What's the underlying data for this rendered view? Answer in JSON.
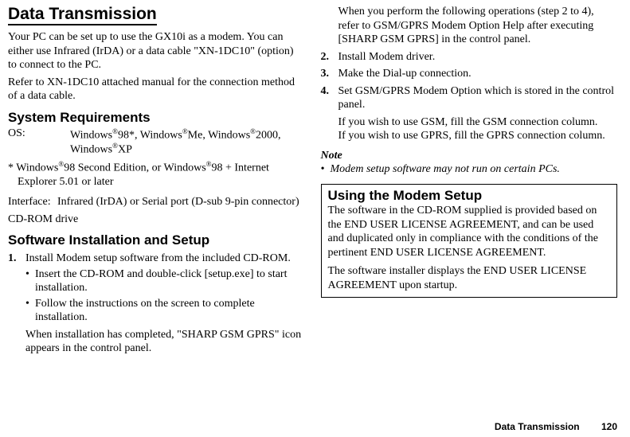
{
  "left": {
    "title": "Data Transmission",
    "p1": "Your PC can be set up to use the GX10i as a modem. You can either use Infrared (IrDA) or a data cable \"XN-1DC10\" (option) to connect to the PC.",
    "p2": "Refer to XN-1DC10 attached manual for the connection method of a data cable.",
    "sysreq_title": "System Requirements",
    "os_label": "OS:",
    "os_val_a": "Windows",
    "os_val_b": "98*, Windows",
    "os_val_c": "Me, Windows",
    "os_val_d": "2000, Windows",
    "os_val_e": "XP",
    "fn_a": "* Windows",
    "fn_b": "98 Second Edition, or Windows",
    "fn_c": "98 + Internet Explorer 5.01 or later",
    "iface_label": "Interface:",
    "iface_val": "Infrared (IrDA) or Serial port (D-sub 9-pin connector)",
    "cdrom": "CD-ROM drive",
    "sw_title": "Software Installation and Setup",
    "steps": [
      {
        "num": "1.",
        "text": "Install Modem setup software from the included CD-ROM.",
        "bullets": [
          "Insert the CD-ROM and double-click [setup.exe] to start installation.",
          "Follow the instructions on the screen to complete installation."
        ],
        "follow": "When installation has completed, \"SHARP GSM GPRS\" icon appears in the control panel."
      }
    ]
  },
  "right": {
    "cont": "When you perform the following operations (step 2 to 4), refer to GSM/GPRS Modem Option Help after executing [SHARP GSM GPRS] in the control panel.",
    "steps": [
      {
        "num": "2.",
        "text": "Install Modem driver."
      },
      {
        "num": "3.",
        "text": "Make the Dial-up connection."
      },
      {
        "num": "4.",
        "text": "Set GSM/GPRS Modem Option which is stored in the control panel.",
        "follow1": "If you wish to use GSM, fill the GSM connection column.",
        "follow2": "If you wish to use GPRS, fill the GPRS connection column."
      }
    ],
    "note_head": "Note",
    "note_body": "Modem setup software may not run on certain PCs.",
    "box": {
      "title": "Using the Modem Setup",
      "p1": "The software in the CD-ROM supplied is provided based on the END USER LICENSE AGREEMENT, and can be used and duplicated only in compliance with the conditions of the pertinent END USER LICENSE AGREEMENT.",
      "p2": "The software installer displays the END USER LICENSE AGREEMENT upon startup."
    }
  },
  "footer": {
    "label": "Data Transmission",
    "page": "120"
  },
  "reg": "®"
}
